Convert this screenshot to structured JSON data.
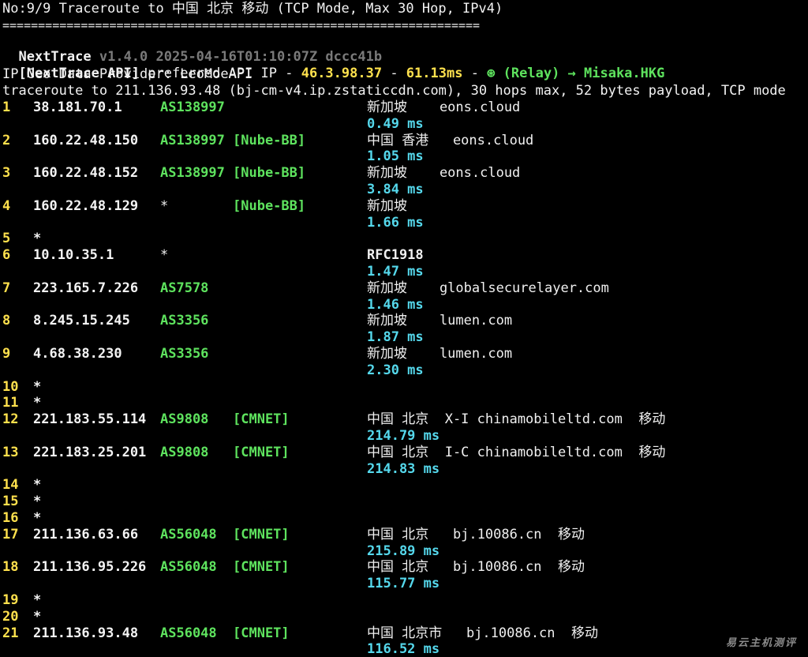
{
  "header": {
    "title": "No:9/9 Traceroute to 中国 北京 移动 (TCP Mode, Max 30 Hop, IPv4)",
    "separator": "===================================================================",
    "app_name": "NextTrace",
    "version": "v1.4.0 2025-04-16T01:10:07Z dccc41b",
    "api_label": "[NextTrace API]",
    "api_text": " preferred API IP - ",
    "api_ip": "46.3.98.37",
    "api_dash1": " - ",
    "api_latency": "61.13ms",
    "api_dash2": " - ",
    "relay_icon": "⊛",
    "relay_text": " (Relay) → Misaka.HKG",
    "geo_provider": "IP Geo Data Provider: LeoMoeAPI",
    "traceroute_line": "traceroute to 211.136.93.48 (bj-cm-v4.ip.zstaticcdn.com), 30 hops max, 52 bytes payload, TCP mode"
  },
  "hops": [
    {
      "num": "1",
      "ip": "38.181.70.1",
      "as": "AS138997",
      "tag": "",
      "geo": "新加坡    eons.cloud",
      "rtt": "0.49 ms"
    },
    {
      "num": "2",
      "ip": "160.22.48.150",
      "as": "AS138997",
      "tag": "[Nube-BB]",
      "geo": "中国 香港   eons.cloud",
      "rtt": "1.05 ms"
    },
    {
      "num": "3",
      "ip": "160.22.48.152",
      "as": "AS138997",
      "tag": "[Nube-BB]",
      "geo": "新加坡    eons.cloud",
      "rtt": "3.84 ms"
    },
    {
      "num": "4",
      "ip": "160.22.48.129",
      "as": "*",
      "tag": "[Nube-BB]",
      "geo": "新加坡",
      "rtt": "1.66 ms"
    },
    {
      "num": "5",
      "ip": "*",
      "as": "",
      "tag": "",
      "geo": "",
      "rtt": ""
    },
    {
      "num": "6",
      "ip": "10.10.35.1",
      "as": "*",
      "tag": "",
      "geo": "RFC1918",
      "rtt": "1.47 ms"
    },
    {
      "num": "7",
      "ip": "223.165.7.226",
      "as": "AS7578",
      "tag": "",
      "geo": "新加坡    globalsecurelayer.com",
      "rtt": "1.46 ms"
    },
    {
      "num": "8",
      "ip": "8.245.15.245",
      "as": "AS3356",
      "tag": "",
      "geo": "新加坡    lumen.com",
      "rtt": "1.87 ms"
    },
    {
      "num": "9",
      "ip": "4.68.38.230",
      "as": "AS3356",
      "tag": "",
      "geo": "新加坡    lumen.com",
      "rtt": "2.30 ms"
    },
    {
      "num": "10",
      "ip": "*",
      "as": "",
      "tag": "",
      "geo": "",
      "rtt": ""
    },
    {
      "num": "11",
      "ip": "*",
      "as": "",
      "tag": "",
      "geo": "",
      "rtt": ""
    },
    {
      "num": "12",
      "ip": "221.183.55.114",
      "as": "AS9808",
      "tag": "[CMNET]",
      "geo": "中国 北京  X-I chinamobileltd.com  移动",
      "rtt": "214.79 ms"
    },
    {
      "num": "13",
      "ip": "221.183.25.201",
      "as": "AS9808",
      "tag": "[CMNET]",
      "geo": "中国 北京  I-C chinamobileltd.com  移动",
      "rtt": "214.83 ms"
    },
    {
      "num": "14",
      "ip": "*",
      "as": "",
      "tag": "",
      "geo": "",
      "rtt": ""
    },
    {
      "num": "15",
      "ip": "*",
      "as": "",
      "tag": "",
      "geo": "",
      "rtt": ""
    },
    {
      "num": "16",
      "ip": "*",
      "as": "",
      "tag": "",
      "geo": "",
      "rtt": ""
    },
    {
      "num": "17",
      "ip": "211.136.63.66",
      "as": "AS56048",
      "tag": "[CMNET]",
      "geo": "中国 北京   bj.10086.cn  移动",
      "rtt": "215.89 ms"
    },
    {
      "num": "18",
      "ip": "211.136.95.226",
      "as": "AS56048",
      "tag": "[CMNET]",
      "geo": "中国 北京   bj.10086.cn  移动",
      "rtt": "115.77 ms"
    },
    {
      "num": "19",
      "ip": "*",
      "as": "",
      "tag": "",
      "geo": "",
      "rtt": ""
    },
    {
      "num": "20",
      "ip": "*",
      "as": "",
      "tag": "",
      "geo": "",
      "rtt": ""
    },
    {
      "num": "21",
      "ip": "211.136.93.48",
      "as": "AS56048",
      "tag": "[CMNET]",
      "geo": "中国 北京市   bj.10086.cn  移动",
      "rtt": "116.52 ms"
    }
  ],
  "watermark": "易云主机测评"
}
